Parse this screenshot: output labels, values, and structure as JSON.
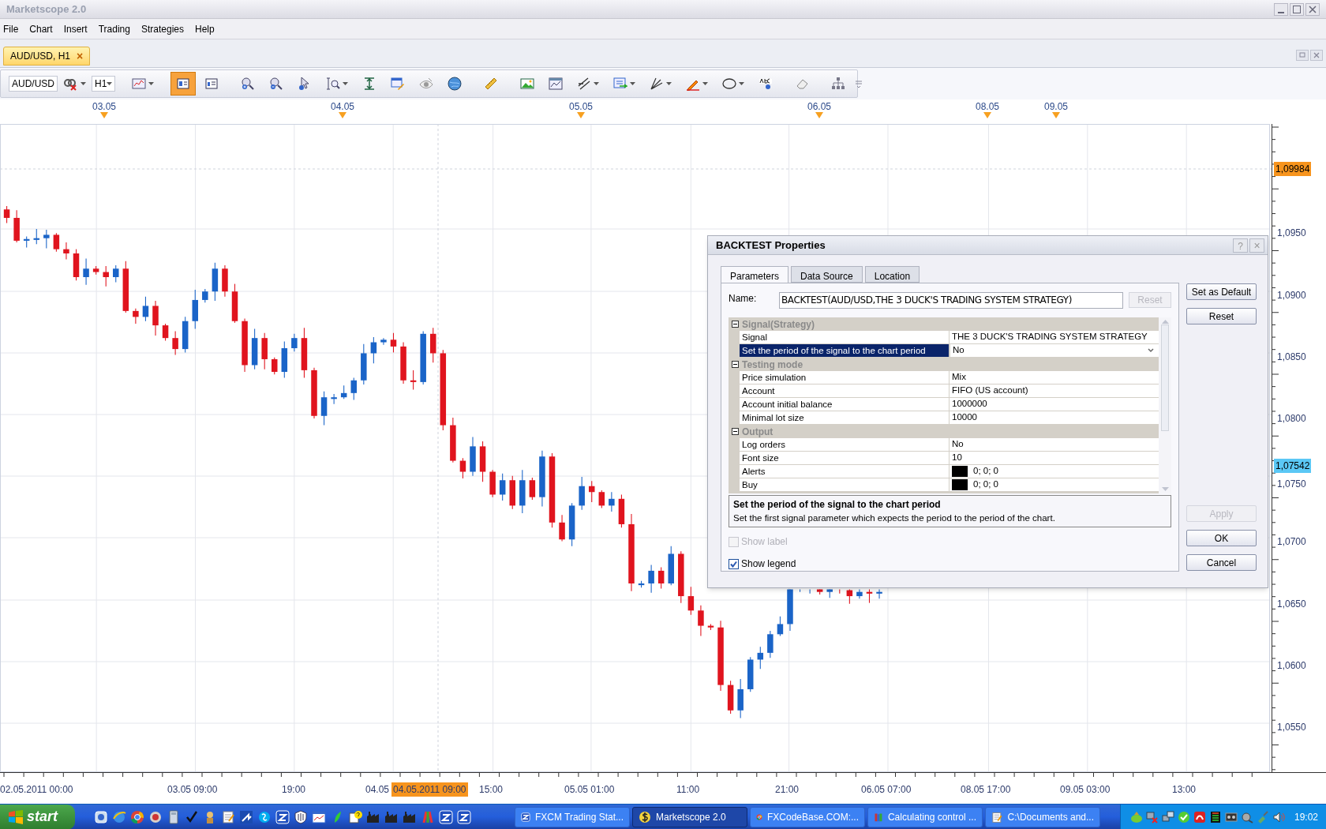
{
  "window": {
    "title": "Marketscope 2.0"
  },
  "menu": [
    "File",
    "Chart",
    "Insert",
    "Trading",
    "Strategies",
    "Help"
  ],
  "chart_tabs": [
    {
      "label": "AUD/USD, H1",
      "close": "×",
      "selected": true
    }
  ],
  "toolbar": {
    "symbol": "AUD/USD",
    "timeframe": "H1",
    "buttons": [
      {
        "selected": false
      },
      {
        "selected": true
      },
      {
        "selected": false
      },
      {
        "selected": false
      },
      {
        "selected": false
      },
      {
        "selected": false
      },
      {
        "selected": false
      },
      {
        "selected": false
      },
      {
        "selected": false
      },
      {
        "selected": false
      },
      {
        "selected": false
      },
      {
        "selected": false
      },
      {
        "selected": false
      },
      {
        "selected": false
      },
      {
        "selected": false
      },
      {
        "selected": false
      },
      {
        "selected": false
      },
      {
        "selected": false
      },
      {
        "selected": false
      },
      {
        "selected": false
      },
      {
        "selected": false
      },
      {
        "selected": false
      }
    ]
  },
  "chart": {
    "top_dates": [
      "03.05",
      "04.05",
      "05.05",
      "06.05",
      "08.05",
      "09.05"
    ],
    "price_ticks": [
      "1,0950",
      "1,0900",
      "1,0850",
      "1,0800",
      "1,0750",
      "1,0700",
      "1,0650",
      "1,0600",
      "1,0550"
    ],
    "price_markers": [
      {
        "label": "1,09984",
        "color": "#f7941d"
      },
      {
        "label": "1,07542",
        "color": "#5bc8f5"
      }
    ],
    "time_ticks": [
      {
        "label": "02.05.2011 00:00",
        "highlighted": false
      },
      {
        "label": "03.05 09:00",
        "highlighted": false
      },
      {
        "label": "19:00",
        "highlighted": false
      },
      {
        "label": "04.05",
        "highlighted": false
      },
      {
        "label": "04.05.2011 09:00",
        "highlighted": true
      },
      {
        "label": "15:00",
        "highlighted": false
      },
      {
        "label": "05.05 01:00",
        "highlighted": false
      },
      {
        "label": "11:00",
        "highlighted": false
      },
      {
        "label": "21:00",
        "highlighted": false
      },
      {
        "label": "06.05 07:00",
        "highlighted": false
      },
      {
        "label": "08.05 17:00",
        "highlighted": false
      },
      {
        "label": "09.05 03:00",
        "highlighted": false
      },
      {
        "label": "13:00",
        "highlighted": false
      }
    ]
  },
  "dialog": {
    "title": "BACKTEST Properties",
    "help": "?",
    "close": "×",
    "tabs": [
      {
        "label": "Parameters",
        "selected": true
      },
      {
        "label": "Data Source",
        "selected": false
      },
      {
        "label": "Location",
        "selected": false
      }
    ],
    "name_label": "Name:",
    "name_value": "BACKTEST(AUD/USD,THE 3 DUCK'S TRADING SYSTEM STRATEGY)",
    "name_reset": {
      "label": "Reset",
      "disabled": true
    },
    "categories": [
      {
        "label": "Signal(Strategy)",
        "expanded": true,
        "rows": [
          {
            "name": "Signal",
            "value": "THE 3 DUCK'S TRADING SYSTEM STRATEGY",
            "kind": "text",
            "selected": false
          },
          {
            "name": "Set the period of the signal to the chart period",
            "value": "No",
            "kind": "dropdown",
            "selected": true
          }
        ]
      },
      {
        "label": "Testing mode",
        "expanded": true,
        "rows": [
          {
            "name": "Price simulation",
            "value": "Mix",
            "kind": "text",
            "selected": false
          },
          {
            "name": "Account",
            "value": "FIFO (US account)",
            "kind": "text",
            "selected": false
          },
          {
            "name": "Account initial balance",
            "value": "1000000",
            "kind": "text",
            "selected": false
          },
          {
            "name": "Minimal lot size",
            "value": "10000",
            "kind": "text",
            "selected": false
          }
        ]
      },
      {
        "label": "Output",
        "expanded": true,
        "rows": [
          {
            "name": "Log orders",
            "value": "No",
            "kind": "text",
            "selected": false
          },
          {
            "name": "Font size",
            "value": "10",
            "kind": "text",
            "selected": false
          },
          {
            "name": "Alerts",
            "value": "0; 0; 0",
            "kind": "color",
            "color": "#000000",
            "selected": false
          },
          {
            "name": "Buy",
            "value": "0; 0; 0",
            "kind": "color",
            "color": "#000000",
            "selected": false
          }
        ]
      }
    ],
    "description": {
      "title": "Set the period of the signal to the chart period",
      "text": "Set the first signal parameter which expects the period to the period of the chart."
    },
    "checkboxes": [
      {
        "label": "Show label",
        "checked": false,
        "disabled": true
      },
      {
        "label": "Show legend",
        "checked": true,
        "disabled": false
      }
    ],
    "side_buttons": [
      {
        "label": "Set as Default",
        "disabled": false
      },
      {
        "label": "Reset",
        "disabled": false
      }
    ],
    "bottom_buttons": [
      {
        "label": "Apply",
        "disabled": true
      },
      {
        "label": "OK",
        "disabled": false
      },
      {
        "label": "Cancel",
        "disabled": false
      }
    ]
  },
  "taskbar": {
    "start": "start",
    "tasks": [
      {
        "label": "FXCM Trading Stat...",
        "selected": false
      },
      {
        "label": "Marketscope 2.0",
        "selected": true
      },
      {
        "label": "FXCodeBase.COM:...",
        "selected": false
      },
      {
        "label": "Calculating control ...",
        "selected": false
      },
      {
        "label": "C:\\Documents and...",
        "selected": false
      }
    ],
    "clock": "19:02"
  }
}
